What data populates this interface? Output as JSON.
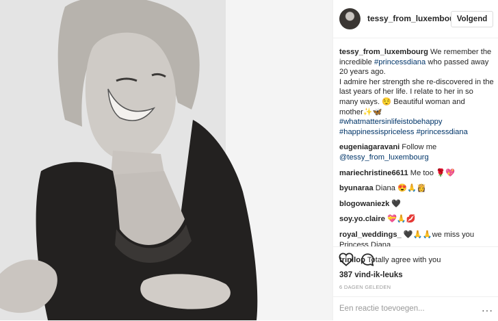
{
  "post": {
    "username": "tessy_from_luxembourg",
    "follow_label": "Volgend",
    "caption": {
      "user": "tessy_from_luxembourg",
      "text1": "We remember the incredible ",
      "hashtag1": "#princessdiana",
      "text2": " who passed away 20 years ago.",
      "text3": "I admire her strength she re-discovered in the last years of her life. I relate to her in so many ways. 😌 Beautiful woman and mother✨🦋",
      "hashtag2": "#whatmattersinlifeistobehappy",
      "hashtag3": "#happinessispriceless",
      "hashtag4": "#princessdiana"
    },
    "comments": [
      {
        "user": "eugeniagaravani",
        "text": "Follow me",
        "mention": "@tessy_from_luxembourg"
      },
      {
        "user": "mariechristine6611",
        "text": "Me too 🌹💖"
      },
      {
        "user": "byunaraa",
        "text": "Diana 😍🙏👸"
      },
      {
        "user": "blogowaniezk",
        "text": "🖤"
      },
      {
        "user": "soy.yo.claire",
        "text": "💝🙏💋"
      },
      {
        "user": "royal_weddings_",
        "text": "🖤🙏🙏we miss you Princess Diana"
      },
      {
        "user": "trinilop",
        "text": "Totally agree with you"
      }
    ],
    "likes": "387 vind-ik-leuks",
    "timestamp": "6 DAGEN GELEDEN",
    "add_comment_placeholder": "Een reactie toevoegen...",
    "more_label": "···"
  },
  "icons": {
    "like": "heart-outline-icon",
    "comment": "speech-bubble-icon",
    "more": "more-options-icon"
  },
  "colors": {
    "link": "#003569",
    "text": "#262626",
    "muted": "#999999",
    "border": "#efefef"
  }
}
